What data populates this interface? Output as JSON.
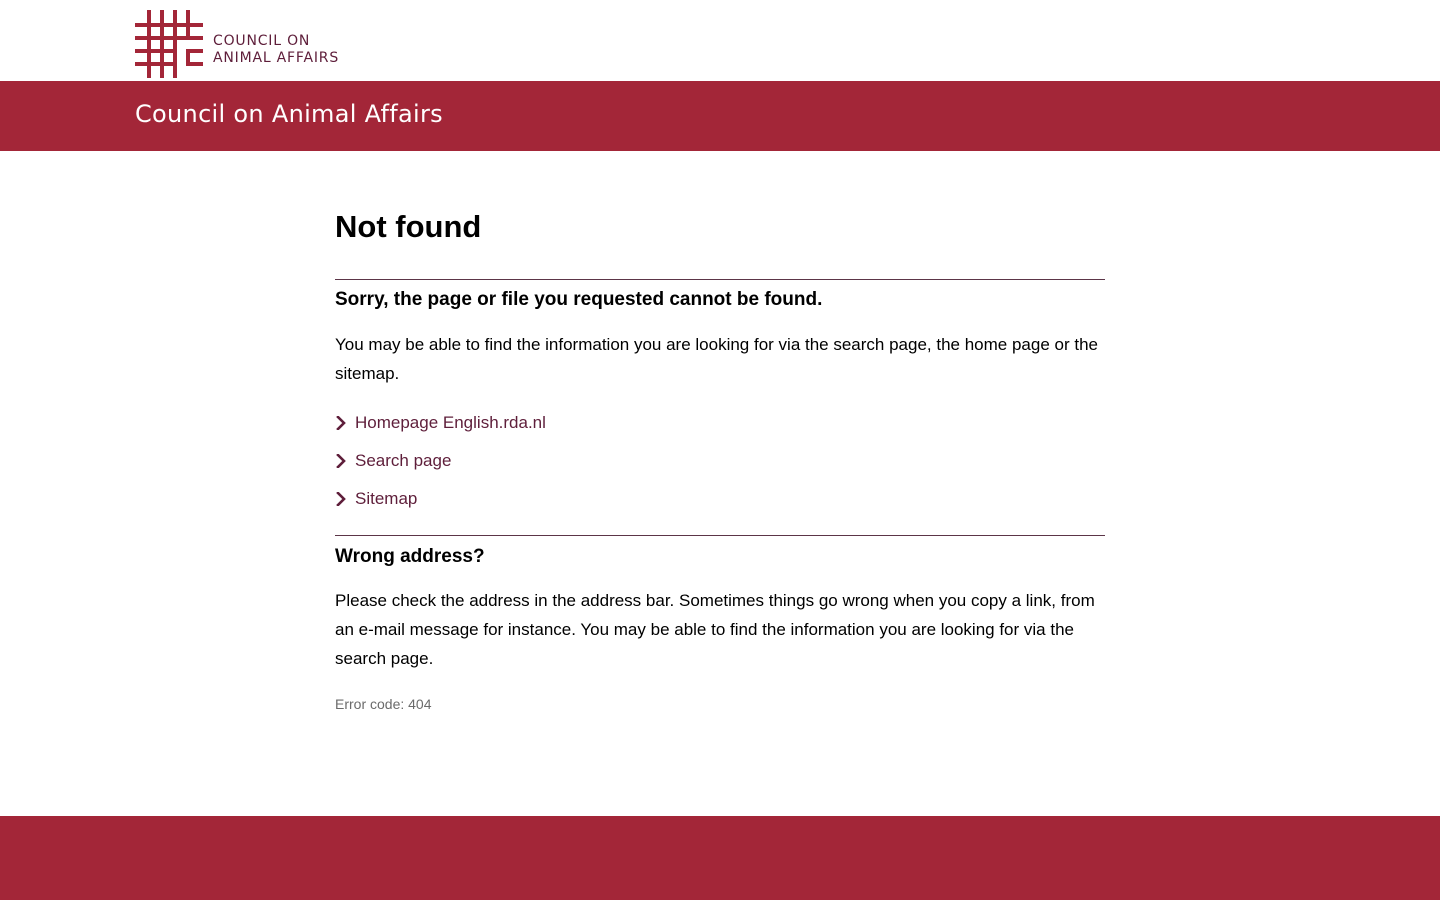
{
  "site": {
    "logo_line1": "COUNCIL ON",
    "logo_line2": "ANIMAL AFFAIRS",
    "banner_title": "Council on Animal Affairs"
  },
  "colors": {
    "brand_red": "#a32638",
    "link_purple": "#5e1e3a",
    "divider": "#5c3548"
  },
  "content": {
    "title": "Not found",
    "section1": {
      "heading": "Sorry, the page or file you requested cannot be found.",
      "text": "You may be able to find the information you are looking for via the search page, the home page or the sitemap."
    },
    "links": [
      {
        "label": "Homepage English.rda.nl",
        "icon": "chevron-right-icon"
      },
      {
        "label": "Search page",
        "icon": "chevron-right-icon"
      },
      {
        "label": "Sitemap",
        "icon": "chevron-right-icon"
      }
    ],
    "section2": {
      "heading": "Wrong address?",
      "text": "Please check the address in the address bar. Sometimes things go wrong when you copy a link, from an e-mail message for instance. You may be able to find the information you are looking for via the search page."
    },
    "error_code": "Error code: 404"
  }
}
